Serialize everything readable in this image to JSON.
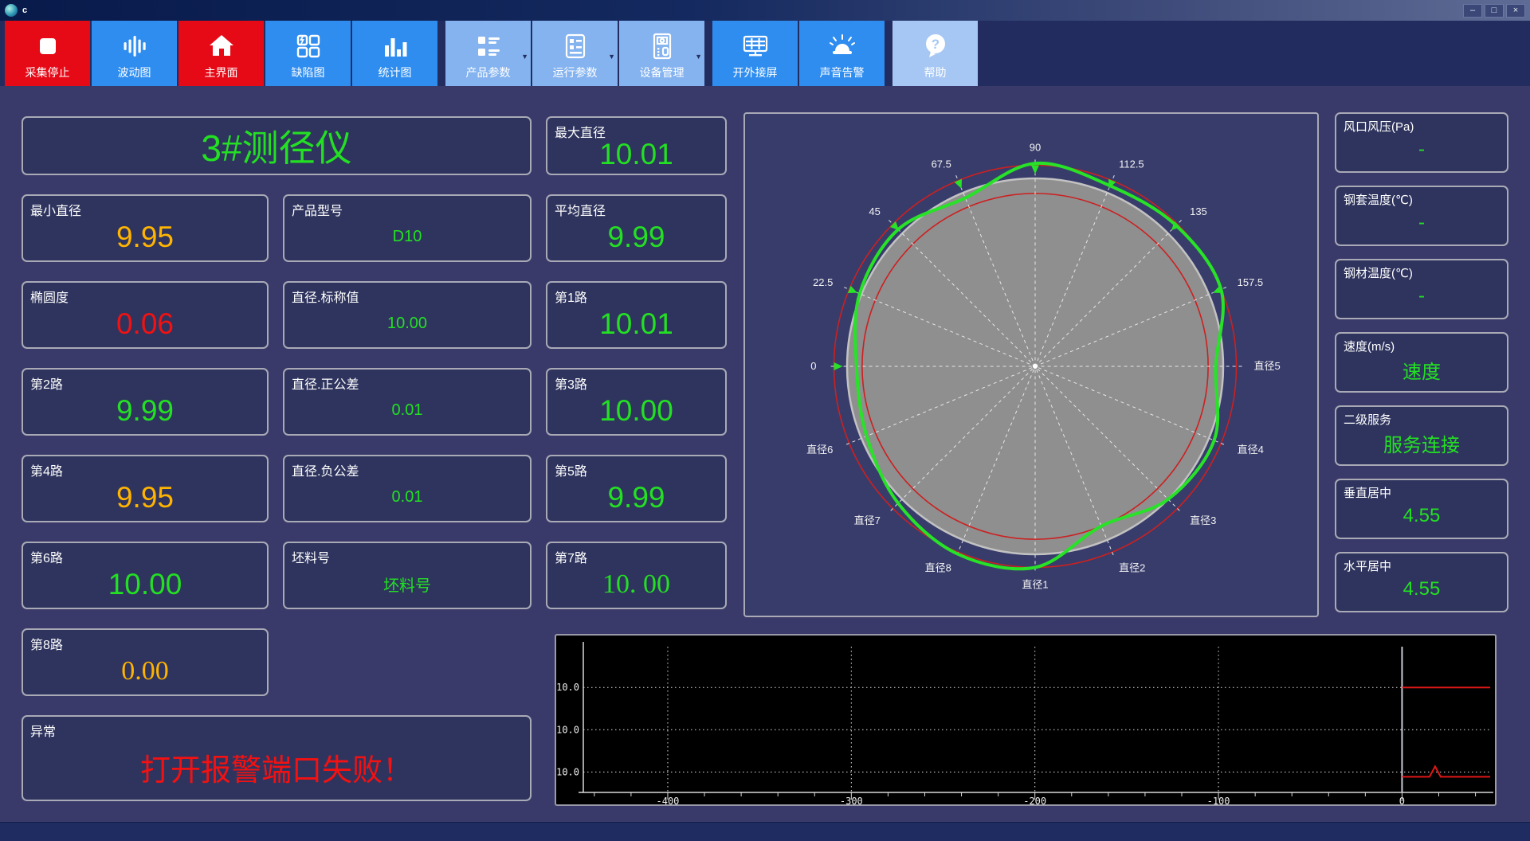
{
  "colors": {
    "green": "#23e023",
    "orange": "#ffb400",
    "red": "#f31111",
    "label": "#ffffff"
  },
  "window": {
    "title": "c",
    "min": "–",
    "max": "□",
    "close": "×"
  },
  "toolbar": {
    "buttons": [
      {
        "label": "采集停止",
        "style": "red",
        "icon": "stop-icon"
      },
      {
        "label": "波动图",
        "style": "blue",
        "icon": "waveform-icon"
      },
      {
        "label": "主界面",
        "style": "red",
        "icon": "home-icon"
      },
      {
        "label": "缺陷图",
        "style": "blue",
        "icon": "defect-grid-icon"
      },
      {
        "label": "统计图",
        "style": "blue",
        "icon": "bar-chart-icon"
      },
      {
        "label": "产品参数",
        "style": "light",
        "icon": "product-params-icon",
        "dropdown": "▼"
      },
      {
        "label": "运行参数",
        "style": "light",
        "icon": "run-params-icon",
        "dropdown": "▼"
      },
      {
        "label": "设备管理",
        "style": "light",
        "icon": "device-manage-icon",
        "dropdown": "▼"
      },
      {
        "label": "开外接屏",
        "style": "blue",
        "icon": "external-screen-icon"
      },
      {
        "label": "声音告警",
        "style": "blue",
        "icon": "sound-alarm-icon"
      },
      {
        "label": "帮助",
        "style": "lighter",
        "icon": "help-icon"
      }
    ]
  },
  "gauge": {
    "title": "3#测径仪"
  },
  "metrics": {
    "max_dia": {
      "label": "最大直径",
      "value": "10.01",
      "color": "green"
    },
    "min_dia": {
      "label": "最小直径",
      "value": "9.95",
      "color": "orange"
    },
    "product_model": {
      "label": "产品型号",
      "value": "D10",
      "color": "green"
    },
    "avg_dia": {
      "label": "平均直径",
      "value": "9.99",
      "color": "green"
    },
    "ovality": {
      "label": "椭圆度",
      "value": "0.06",
      "color": "red"
    },
    "dia_nominal": {
      "label": "直径.标称值",
      "value": "10.00",
      "color": "green"
    },
    "ch1": {
      "label": "第1路",
      "value": "10.01",
      "color": "green"
    },
    "ch2": {
      "label": "第2路",
      "value": "9.99",
      "color": "green"
    },
    "dia_pos_tol": {
      "label": "直径.正公差",
      "value": "0.01",
      "color": "green"
    },
    "ch3": {
      "label": "第3路",
      "value": "10.00",
      "color": "green"
    },
    "ch4": {
      "label": "第4路",
      "value": "9.95",
      "color": "orange"
    },
    "dia_neg_tol": {
      "label": "直径.负公差",
      "value": "0.01",
      "color": "green"
    },
    "ch5": {
      "label": "第5路",
      "value": "9.99",
      "color": "green"
    },
    "ch6": {
      "label": "第6路",
      "value": "10.00",
      "color": "green"
    },
    "billet_no": {
      "label": "坯料号",
      "value": "坯料号",
      "color": "green"
    },
    "ch7": {
      "label": "第7路",
      "value": "10. 00",
      "color": "green"
    },
    "ch8": {
      "label": "第8路",
      "value": "0.00",
      "color": "orange"
    }
  },
  "alarm": {
    "label": "异常",
    "value": "打开报警端口失败！",
    "color": "red"
  },
  "right_panel": {
    "wind_pressure": {
      "label": "风口风压(Pa)",
      "value": "-"
    },
    "sleeve_temp": {
      "label": "钢套温度(℃)",
      "value": "-"
    },
    "steel_temp": {
      "label": "钢材温度(℃)",
      "value": "-"
    },
    "speed": {
      "label": "速度(m/s)",
      "value": "速度"
    },
    "l2_service": {
      "label": "二级服务",
      "value": "服务连接"
    },
    "v_center": {
      "label": "垂直居中",
      "value": "4.55"
    },
    "h_center": {
      "label": "水平居中",
      "value": "4.55"
    }
  },
  "chart_data": [
    {
      "type": "polar",
      "name": "cross-section-profile",
      "labels": [
        {
          "text": "90",
          "deg": 90
        },
        {
          "text": "112.5",
          "deg": 67.5
        },
        {
          "text": "135",
          "deg": 45
        },
        {
          "text": "157.5",
          "deg": 22.5
        },
        {
          "text": "直径5",
          "deg": 0
        },
        {
          "text": "直径4",
          "deg": -22.5
        },
        {
          "text": "直径3",
          "deg": -45
        },
        {
          "text": "直径2",
          "deg": -67.5
        },
        {
          "text": "直径1",
          "deg": -90
        },
        {
          "text": "直径8",
          "deg": -112.5
        },
        {
          "text": "直径7",
          "deg": -135
        },
        {
          "text": "直径6",
          "deg": -157.5
        },
        {
          "text": "0",
          "deg": 180
        },
        {
          "text": "22.5",
          "deg": 157.5
        },
        {
          "text": "45",
          "deg": 135
        },
        {
          "text": "67.5",
          "deg": 112.5
        }
      ],
      "marker_degs": [
        180,
        157.5,
        135,
        112.5,
        90,
        67.5,
        45,
        22.5
      ],
      "nominal_radius": 1.0,
      "tolerance_rings": [
        0.92,
        1.07
      ],
      "profile_degs": [
        0,
        22.5,
        45,
        67.5,
        90,
        112.5,
        135,
        157.5,
        180,
        202.5,
        225,
        247.5,
        270,
        292.5,
        315,
        337.5
      ],
      "profile_radii": [
        0.96,
        1.07,
        1.06,
        1.04,
        1.08,
        0.97,
        1.03,
        1.01,
        0.95,
        0.97,
        1.03,
        1.08,
        1.07,
        0.92,
        1.0,
        1.03
      ],
      "colors": {
        "disk": "#8f8f8f",
        "ring": "#cc2020",
        "profile": "#28e228",
        "spokes": "#e6e6e6"
      }
    },
    {
      "type": "line",
      "name": "diameter-trend",
      "x_ticks": [
        -400,
        -300,
        -200,
        -100,
        0
      ],
      "x_minor_step": 20,
      "x_range": [
        -446,
        48
      ],
      "y_grid_labels": [
        "10.0",
        "10.0",
        "10.0"
      ],
      "series": [
        {
          "name": "upper-limit",
          "color": "#e01616",
          "shape": "const-at-grid-0",
          "from_x": 0
        },
        {
          "name": "lower-limit",
          "color": "#e01616",
          "shape": "const-below-grid-2",
          "from_x": 0,
          "spike_x": 18
        }
      ]
    }
  ]
}
